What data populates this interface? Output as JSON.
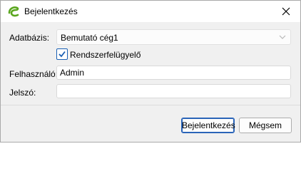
{
  "window": {
    "title": "Bejelentkezés"
  },
  "icons": {
    "app": "app-logo-e-icon",
    "close": "close-icon",
    "dropdown": "chevron-down-icon",
    "check": "check-icon"
  },
  "form": {
    "database_label": "Adatbázis:",
    "database_value": "Bemutató cég1",
    "admin_checkbox_label": "Rendszerfelügyelő",
    "admin_checked": true,
    "username_label": "Felhasználó:",
    "username_value": "Admin",
    "password_label": "Jelszó:",
    "password_value": ""
  },
  "buttons": {
    "login": "Bejelentkezés",
    "cancel": "Mégsem"
  },
  "colors": {
    "accent": "#2a64b8",
    "logo_green": "#5aa61e"
  }
}
